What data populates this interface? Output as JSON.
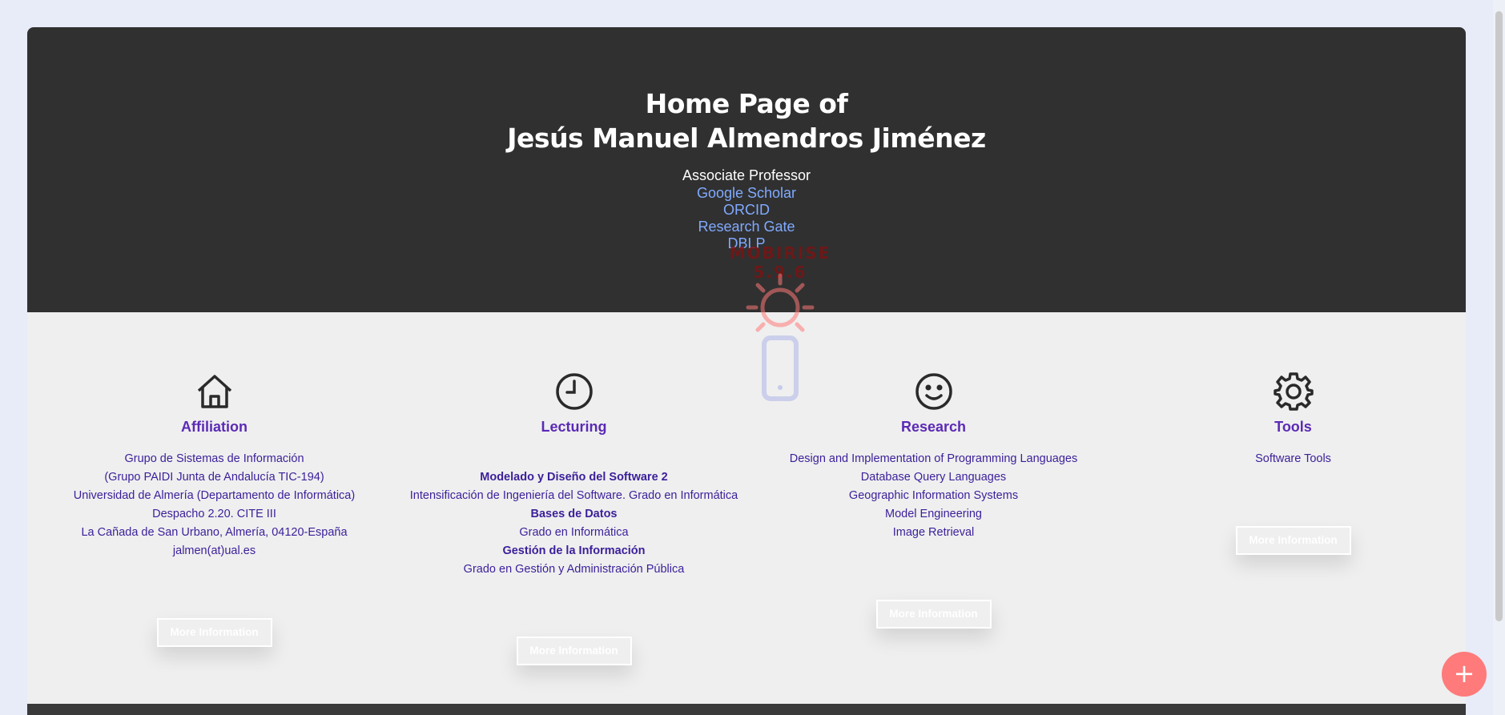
{
  "hero": {
    "title_line1": "Home Page of",
    "title_line2": "Jesús Manuel Almendros Jiménez",
    "role": "Associate Professor",
    "links": [
      "Google Scholar",
      "ORCID",
      "Research Gate",
      "DBLP"
    ]
  },
  "watermark": {
    "text": "MOBIRISE 5.9.6"
  },
  "columns": [
    {
      "icon": "home-icon",
      "title": "Affiliation",
      "lines": [
        {
          "text": "Grupo de Sistemas de Información",
          "bold": false
        },
        {
          "text": "(Grupo PAIDI Junta de Andalucía TIC-194)",
          "bold": false
        },
        {
          "text": "Universidad de Almería (Departamento de Informática)",
          "bold": false
        },
        {
          "text": "Despacho 2.20. CITE III",
          "bold": false
        },
        {
          "text": "La Cañada de San Urbano, Almería, 04120-España",
          "bold": false
        },
        {
          "text": "jalmen(at)ual.es",
          "bold": false
        }
      ],
      "button": "More Information"
    },
    {
      "icon": "clock-icon",
      "title": "Lecturing",
      "lines": [
        {
          "text": "Modelado y Diseño del Software 2",
          "bold": true
        },
        {
          "text": "Intensificación de Ingeniería del Software. Grado en Informática",
          "bold": false
        },
        {
          "text": "Bases de Datos",
          "bold": true
        },
        {
          "text": "Grado en Informática",
          "bold": false
        },
        {
          "text": "Gestión de la Información",
          "bold": true
        },
        {
          "text": "Grado en Gestión y Administración Pública",
          "bold": false
        }
      ],
      "button": "More Information"
    },
    {
      "icon": "smiley-icon",
      "title": "Research",
      "lines": [
        {
          "text": "Design and Implementation of Programming Languages",
          "bold": false
        },
        {
          "text": "Database Query Languages",
          "bold": false
        },
        {
          "text": "Geographic Information Systems",
          "bold": false
        },
        {
          "text": "Model Engineering",
          "bold": false
        },
        {
          "text": "Image Retrieval",
          "bold": false
        }
      ],
      "button": "More Information"
    },
    {
      "icon": "gear-icon",
      "title": "Tools",
      "lines": [
        {
          "text": "Software Tools",
          "bold": false
        }
      ],
      "button": "More Information"
    }
  ],
  "fab": {
    "label": "+"
  },
  "colors": {
    "hero_bg": "#303030",
    "link": "#80aaff",
    "title_purple": "#5b2ab5",
    "fab": "#ff7a7a"
  }
}
